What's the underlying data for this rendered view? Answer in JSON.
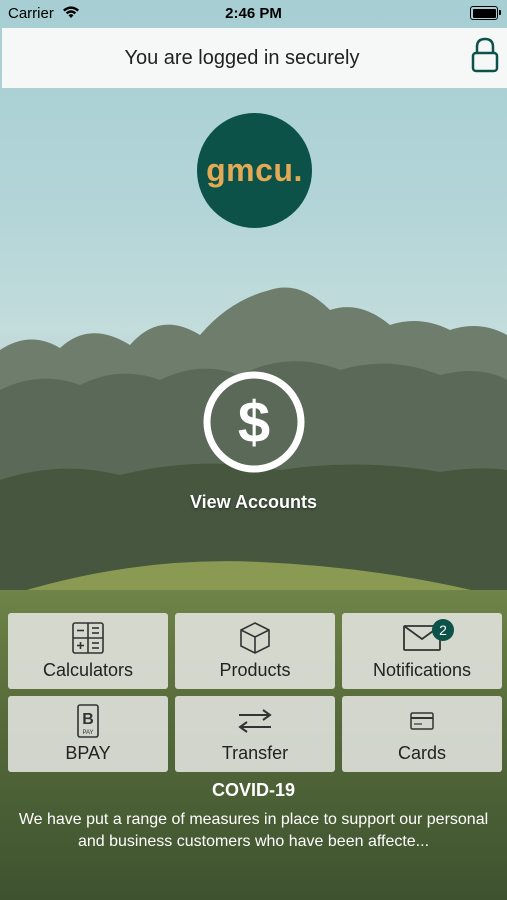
{
  "status_bar": {
    "carrier": "Carrier",
    "time": "2:46 PM"
  },
  "secure_banner": {
    "text": "You are logged in securely"
  },
  "logo": {
    "text": "gmcu."
  },
  "main_action": {
    "label": "View Accounts"
  },
  "tiles": [
    {
      "label": "Calculators",
      "icon": "calculator-icon"
    },
    {
      "label": "Products",
      "icon": "box-icon"
    },
    {
      "label": "Notifications",
      "icon": "envelope-icon",
      "badge": "2"
    },
    {
      "label": "BPAY",
      "icon": "bpay-icon"
    },
    {
      "label": "Transfer",
      "icon": "transfer-arrows-icon"
    },
    {
      "label": "Cards",
      "icon": "card-icon"
    }
  ],
  "covid": {
    "title": "COVID-19",
    "body": "We have put a range of measures in place to support our personal and business customers who have been affecte..."
  },
  "colors": {
    "brand": "#0c5248",
    "logo_text": "#e3a955",
    "banner": "#f5f8f7"
  }
}
